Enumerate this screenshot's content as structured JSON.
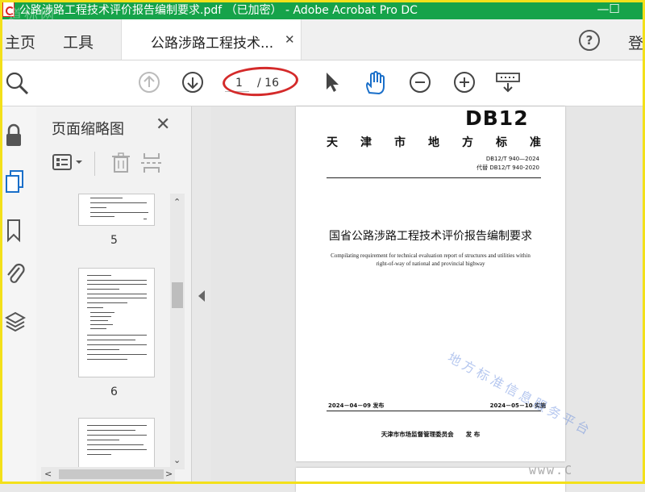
{
  "window": {
    "title": "公路涉路工程技术评价报告编制要求.pdf （已加密） - Adobe Acrobat Pro DC",
    "watermark_logo": "道标网"
  },
  "tabs": {
    "home": "主页",
    "tools": "工具",
    "document": "公路涉路工程技术...",
    "login": "登"
  },
  "toolbar": {
    "current_page": "1",
    "total_pages": "/ 16"
  },
  "panel": {
    "title": "页面缩略图",
    "thumbnails": [
      {
        "label": "5"
      },
      {
        "label": "6"
      },
      {
        "label": ""
      }
    ]
  },
  "document": {
    "logo": "DB12",
    "standard_heading": [
      "天",
      "津",
      "市",
      "地",
      "方",
      "标",
      "准"
    ],
    "code": "DB12/T 940—2024",
    "replaces": "代替 DB12/T 940-2020",
    "title_cn": "国省公路涉路工程技术评价报告编制要求",
    "title_en": "Compilating requirement for technical evaluation report of structures and utilities within right-of-way of national and provincial highway",
    "publish_date": "2024－04－09 发布",
    "implement_date": "2024－05－10 实施",
    "issuer": "天津市市场监督管理委员会　　发 布",
    "stamp": "地方标准信息服务平台"
  },
  "overlay": {
    "url_fragment": "www.C"
  },
  "colors": {
    "titlebar": "#16a34a",
    "accent_blue": "#1a6fc9",
    "annotation_red": "#d42a2a",
    "frame": "#f3e01a"
  }
}
